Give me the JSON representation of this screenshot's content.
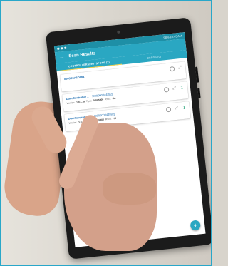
{
  "status_bar": {
    "time": "10:45 AM",
    "battery": "98%"
  },
  "app": {
    "title": "Scan Results",
    "back_icon": "arrow-back-icon"
  },
  "tabs": [
    {
      "label": "CONTROLLERS/HOTSPOTS (3)",
      "active": true
    },
    {
      "label": "DBRDS (0)",
      "active": false
    }
  ],
  "devices": [
    {
      "name": "0000D3A6D984",
      "id": "",
      "version": "",
      "type": "",
      "rssi": ""
    },
    {
      "name": "DoorController 1",
      "id": "[000000044892]",
      "version": "1.0.1.18",
      "type": "DBR5000",
      "rssi": "-64"
    },
    {
      "name": "DoorController 2",
      "id": "[000000044882]",
      "version": "1.0.1.18",
      "type": "DCF300",
      "rssi": "-76"
    }
  ],
  "labels": {
    "version": "Version:",
    "type": "Type:",
    "rssi": "RSSI:"
  },
  "fab_icon": "fab-plus-icon",
  "colors": {
    "accent": "#2aa7c2",
    "status_bar": "#1e8fa6",
    "tab_indicator": "#ffd54f",
    "link_text": "#1f6fb2",
    "download": "#2aa37a"
  }
}
